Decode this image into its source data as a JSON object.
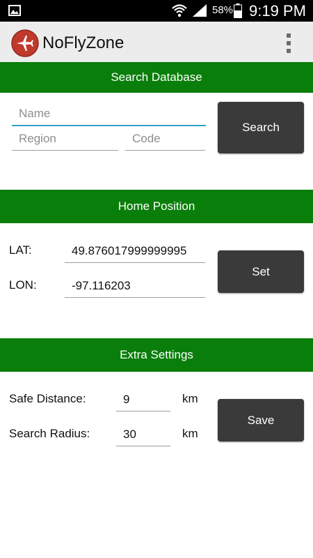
{
  "status_bar": {
    "battery_percent": "58%",
    "time": "9:19 PM",
    "icons": [
      "image-notification-icon",
      "wifi-icon",
      "signal-icon",
      "battery-icon"
    ]
  },
  "app": {
    "title": "NoFlyZone",
    "logo_icon": "airplane-logo-icon",
    "menu_icon": "overflow-menu-icon"
  },
  "search_section": {
    "header": "Search Database",
    "name_placeholder": "Name",
    "region_placeholder": "Region",
    "code_placeholder": "Code",
    "button_label": "Search"
  },
  "home_section": {
    "header": "Home Position",
    "lat_label": "LAT:",
    "lat_value": "49.876017999999995",
    "lon_label": "LON:",
    "lon_value": "-97.116203",
    "button_label": "Set"
  },
  "extra_section": {
    "header": "Extra Settings",
    "safe_distance_label": "Safe Distance:",
    "safe_distance_value": "9",
    "safe_distance_unit": "km",
    "search_radius_label": "Search Radius:",
    "search_radius_value": "30",
    "search_radius_unit": "km",
    "button_label": "Save"
  },
  "colors": {
    "header_green": "#0a7e0a",
    "button_dark": "#3a3a3a",
    "focus_accent": "#2fa3c8",
    "logo_red": "#c0392b"
  }
}
